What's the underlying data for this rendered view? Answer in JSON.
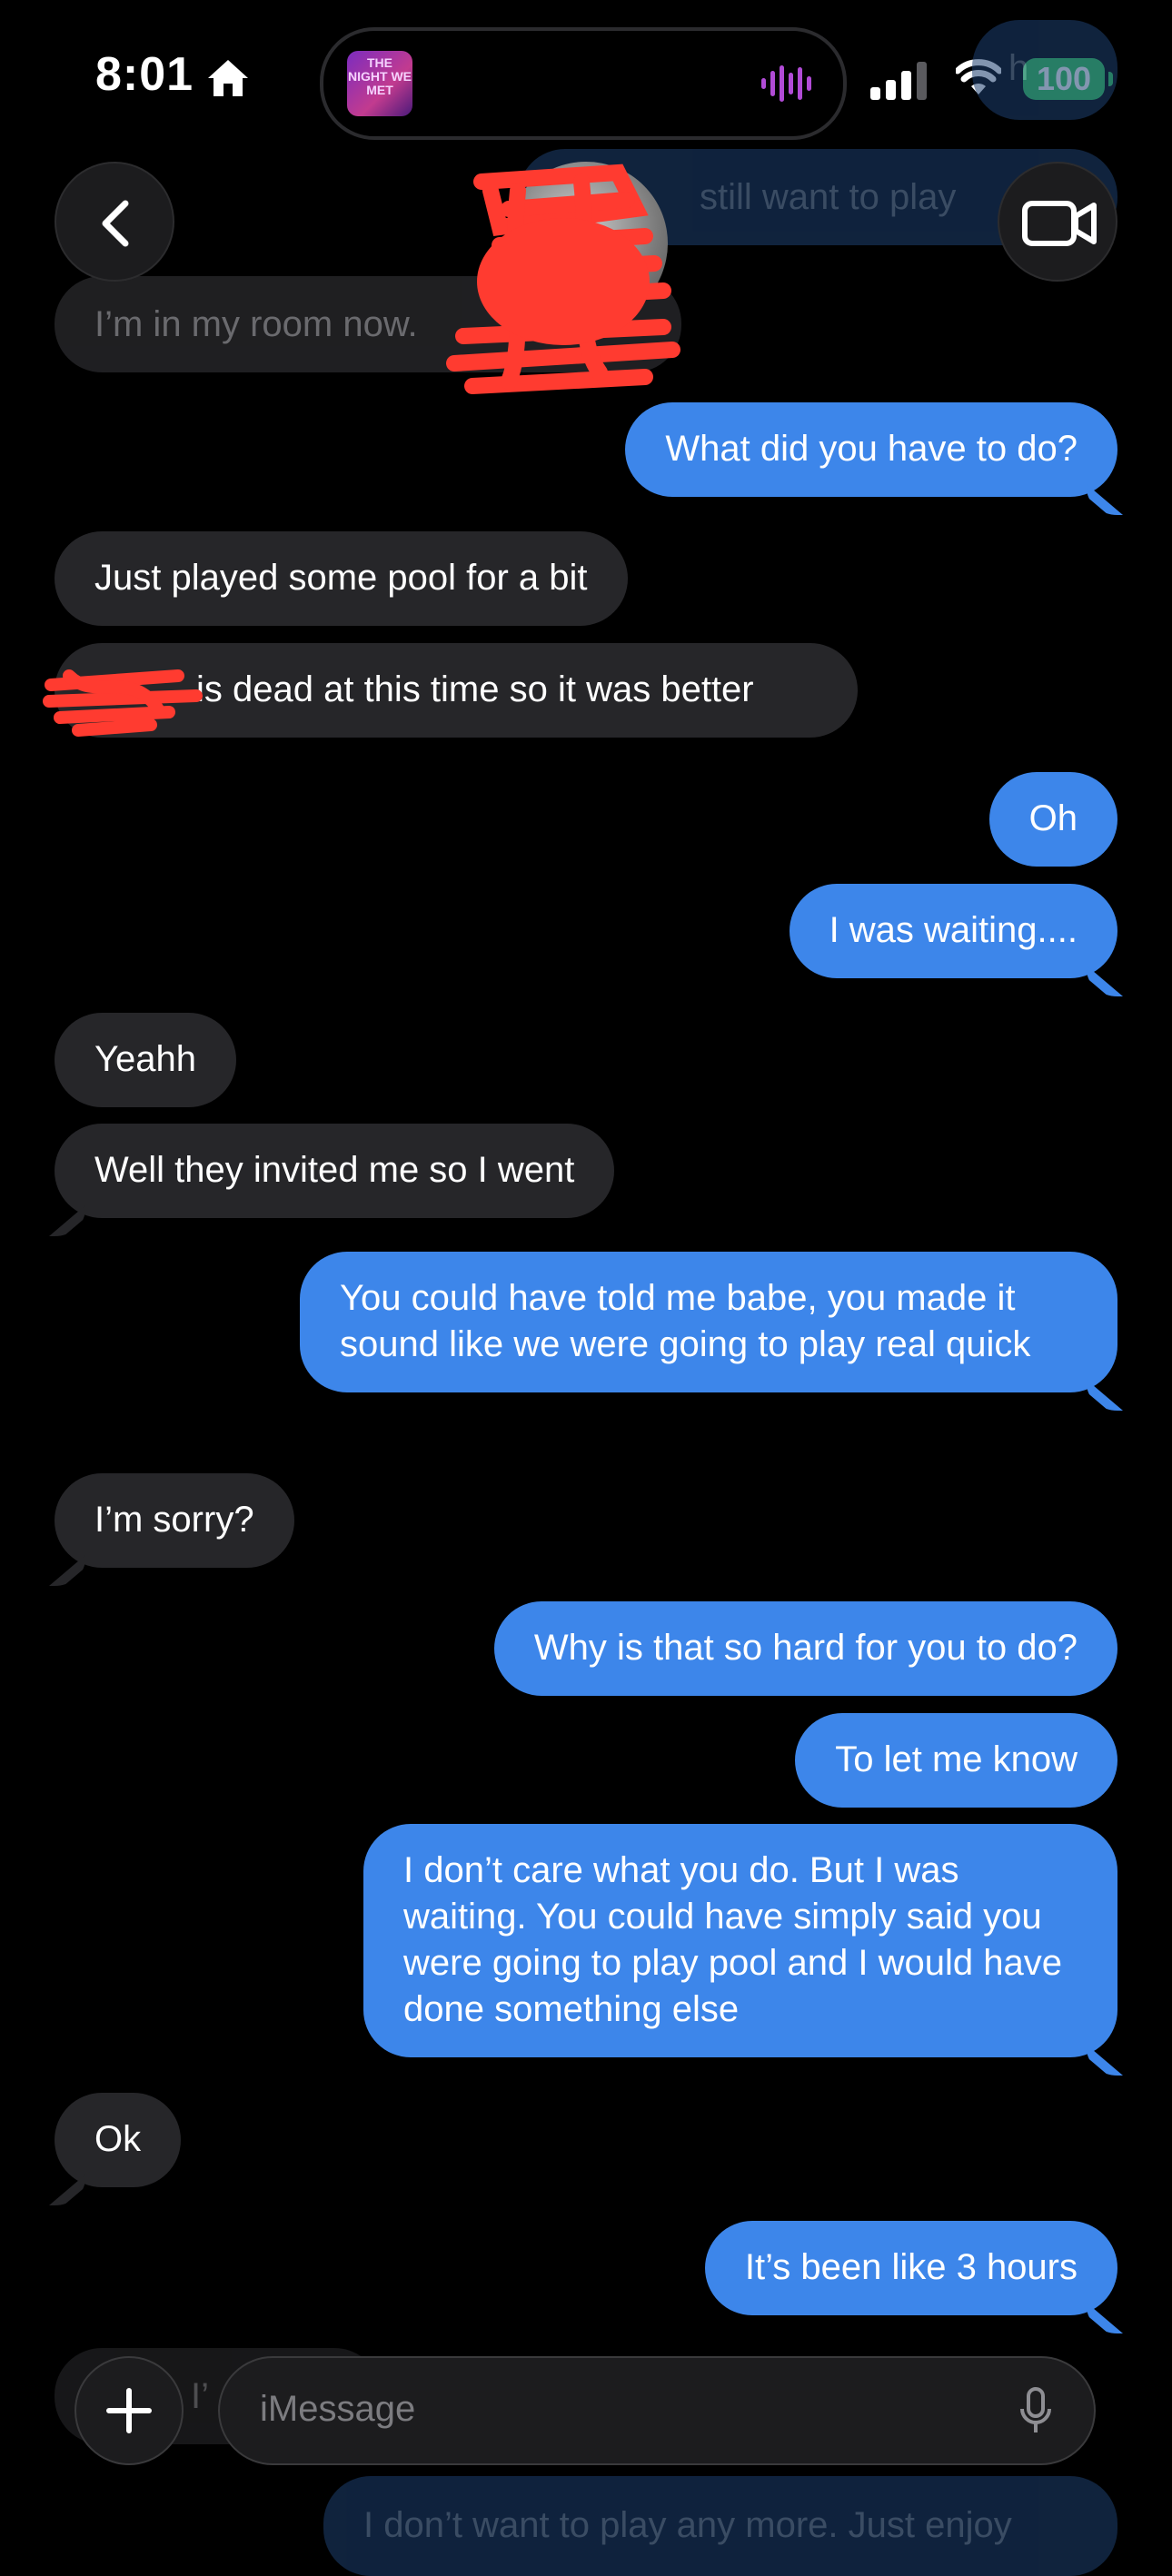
{
  "status_bar": {
    "time": "8:01",
    "battery": "100",
    "now_playing_art": "THE NIGHT WE MET",
    "icons": [
      "home-icon",
      "waveform-icon",
      "cellular-signal-icon",
      "wifi-icon",
      "battery-icon"
    ]
  },
  "nav": {
    "icons": [
      "back-chevron-icon",
      "video-camera-icon"
    ]
  },
  "ghost_text": {
    "top_right_small": "h",
    "top_right": "still want to play",
    "top_left": "I’m in my room now.",
    "bottom_left": "I’",
    "bottom_right": "I don’t want to play any more. Just enjoy"
  },
  "messages": [
    {
      "side": "out",
      "text": "What did you have to do?"
    },
    {
      "side": "in",
      "text": "Just played some pool for a bit"
    },
    {
      "side": "in",
      "text": "is dead at this time so it was better"
    },
    {
      "side": "out",
      "text": "Oh"
    },
    {
      "side": "out",
      "text": "I was waiting...."
    },
    {
      "side": "in",
      "text": "Yeahh"
    },
    {
      "side": "in",
      "text": "Well they invited me so I went"
    },
    {
      "side": "out",
      "text": "You could have told me babe, you made it sound like we were going to play real quick"
    },
    {
      "side": "in",
      "text": "I’m sorry?"
    },
    {
      "side": "out",
      "text": "Why is that so hard for you to do?"
    },
    {
      "side": "out",
      "text": "To let me know"
    },
    {
      "side": "out",
      "text": "I don’t care what you do. But I was waiting. You could have simply said you were going to play pool and I would have done something else"
    },
    {
      "side": "in",
      "text": "Ok"
    },
    {
      "side": "out",
      "text": "It’s been like 3 hours"
    }
  ],
  "compose": {
    "placeholder": "iMessage",
    "icons": [
      "plus-icon",
      "microphone-icon"
    ]
  },
  "colors": {
    "background": "#000000",
    "incoming_bubble": "#262629",
    "outgoing_bubble": "#3d86ea",
    "battery": "#34c759",
    "redaction": "#ff3b30"
  }
}
